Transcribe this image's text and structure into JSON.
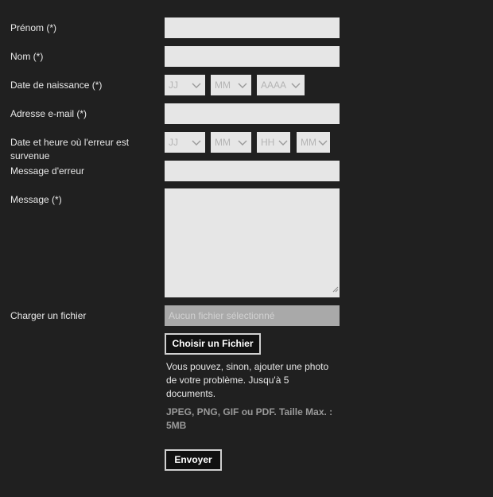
{
  "labels": {
    "prenom": "Prénom (*)",
    "nom": "Nom (*)",
    "naissance": "Date de naissance  (*)",
    "email": "Adresse e-mail (*)",
    "erreur_date": "Date et heure où l'erreur est survenue",
    "message_erreur": "Message d'erreur",
    "message": "Message (*)",
    "fichier": "Charger un fichier"
  },
  "birth": {
    "day": "JJ",
    "month": "MM",
    "year": "AAAA"
  },
  "error_date": {
    "day": "JJ",
    "month": "MM",
    "hour": "HH",
    "minute": "MM"
  },
  "file": {
    "placeholder": "Aucun fichier sélectionné",
    "button": "Choisir un Fichier",
    "help": "Vous pouvez, sinon, ajouter une photo de votre problème. Jusqu'à 5 documents.",
    "formats": "JPEG, PNG, GIF ou PDF. Taille Max. : 5MB"
  },
  "submit": "Envoyer",
  "icons": {
    "select": "chevron-down-icon",
    "resize": "resize-grip-icon"
  }
}
